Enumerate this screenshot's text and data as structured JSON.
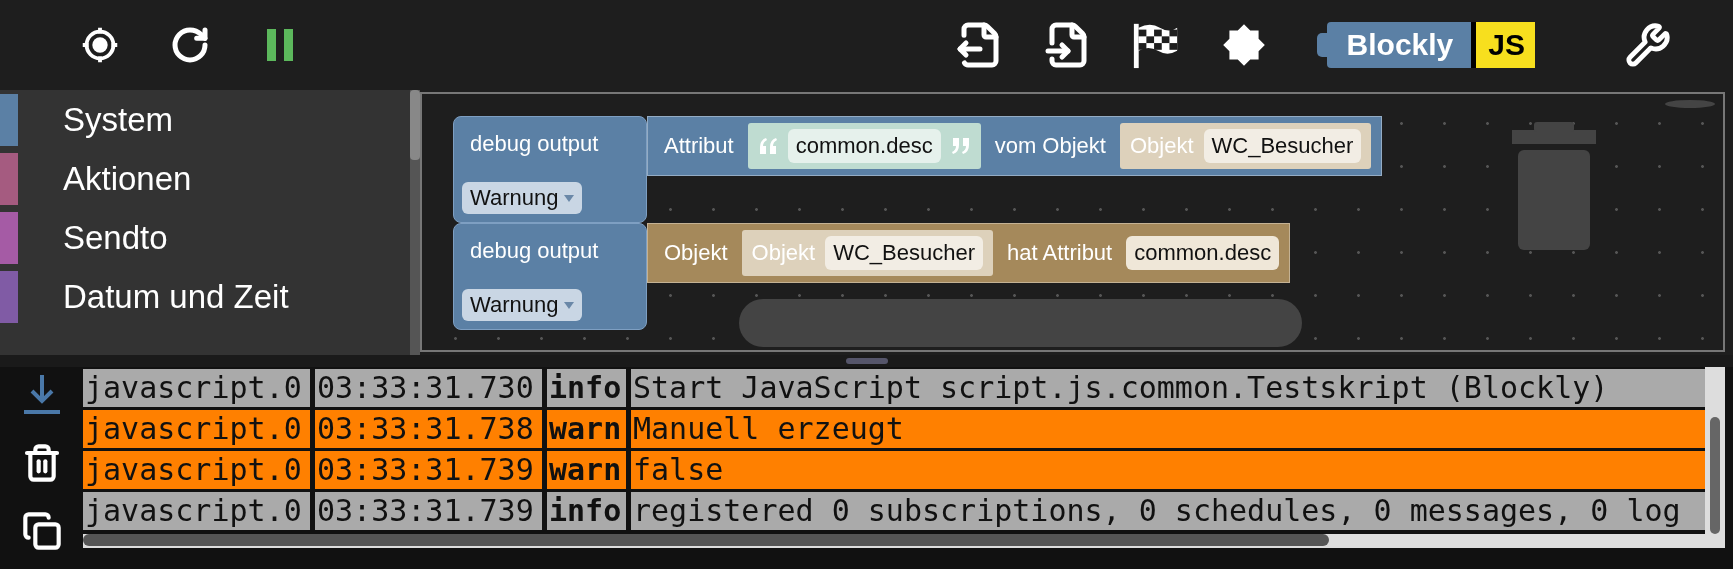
{
  "toolbar": {
    "logo": {
      "left": "Blockly",
      "right": "JS"
    }
  },
  "sidebar": {
    "items": [
      {
        "label": "System",
        "color": "#5b80a5"
      },
      {
        "label": "Aktionen",
        "color": "#a55b80"
      },
      {
        "label": "Sendto",
        "color": "#a55ba5"
      },
      {
        "label": "Datum und Zeit",
        "color": "#805ba5"
      }
    ]
  },
  "workspace": {
    "blocks": [
      {
        "label": "debug output",
        "dropdown": "Warnung",
        "input": {
          "color": "#5b80a5",
          "segments": [
            {
              "kind": "label",
              "text": "Attribut"
            },
            {
              "kind": "string",
              "value": "common.desc"
            },
            {
              "kind": "label",
              "text": "vom Objekt"
            },
            {
              "kind": "object",
              "label": "Objekt",
              "value": "WC_Besucher"
            }
          ]
        }
      },
      {
        "label": "debug output",
        "dropdown": "Warnung",
        "input": {
          "color": "#a5895b",
          "segments": [
            {
              "kind": "label",
              "text": "Objekt"
            },
            {
              "kind": "object",
              "label": "Objekt",
              "value": "WC_Besucher"
            },
            {
              "kind": "label",
              "text": "hat Attribut"
            },
            {
              "kind": "field",
              "value": "common.desc"
            }
          ]
        }
      }
    ]
  },
  "log": {
    "rows": [
      {
        "source": "javascript.0",
        "time": "03:33:31.730",
        "level": "info",
        "message": "Start JavaScript script.js.common.Testskript (Blockly)",
        "color": "#aaaaaa"
      },
      {
        "source": "javascript.0",
        "time": "03:33:31.738",
        "level": "warn",
        "message": "Manuell erzeugt",
        "color": "#ff8000"
      },
      {
        "source": "javascript.0",
        "time": "03:33:31.739",
        "level": "warn",
        "message": "false",
        "color": "#ff8000"
      },
      {
        "source": "javascript.0",
        "time": "03:33:31.739",
        "level": "info",
        "message": "registered 0 subscriptions, 0 schedules, 0 messages, 0 log",
        "color": "#aaaaaa"
      }
    ]
  }
}
